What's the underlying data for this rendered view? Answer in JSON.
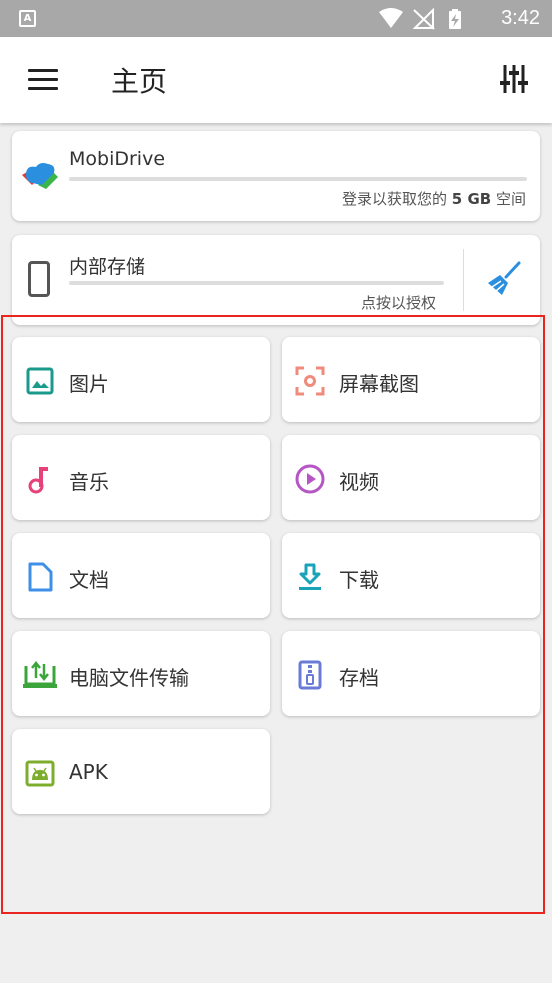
{
  "status_bar": {
    "notification_icon": "A",
    "icons": [
      "wifi-icon",
      "no-signal-icon",
      "battery-charging-icon"
    ],
    "time": "3:42"
  },
  "app_bar": {
    "menu_icon": "hamburger-icon",
    "title": "主页",
    "settings_icon": "equalizer-settings-icon"
  },
  "drive_card": {
    "name": "MobiDrive",
    "subtitle_prefix": "登录以获取您的",
    "subtitle_size": "5 GB",
    "subtitle_suffix": "空间"
  },
  "storage_card": {
    "name": "内部存储",
    "subtitle": "点按以授权",
    "clean_icon": "broom-icon"
  },
  "categories": [
    {
      "label": "图片",
      "icon": "image-icon",
      "color": "#1a9a8a"
    },
    {
      "label": "屏幕截图",
      "icon": "screenshot-icon",
      "color": "#ef8a7d"
    },
    {
      "label": "音乐",
      "icon": "music-note-icon",
      "color": "#e8407a"
    },
    {
      "label": "视频",
      "icon": "play-circle-icon",
      "color": "#b556c4"
    },
    {
      "label": "文档",
      "icon": "document-icon",
      "color": "#3d8fe8"
    },
    {
      "label": "下载",
      "icon": "download-icon",
      "color": "#18a3b8"
    },
    {
      "label": "电脑文件传输",
      "icon": "pc-transfer-icon",
      "color": "#3ba53b"
    },
    {
      "label": "存档",
      "icon": "archive-icon",
      "color": "#6a7ad6"
    },
    {
      "label": "APK",
      "icon": "android-icon",
      "color": "#7cae2c"
    }
  ],
  "colors": {
    "highlight_border": "#e8261f",
    "status_bar": "#a8a8a8",
    "background": "#efefef"
  }
}
